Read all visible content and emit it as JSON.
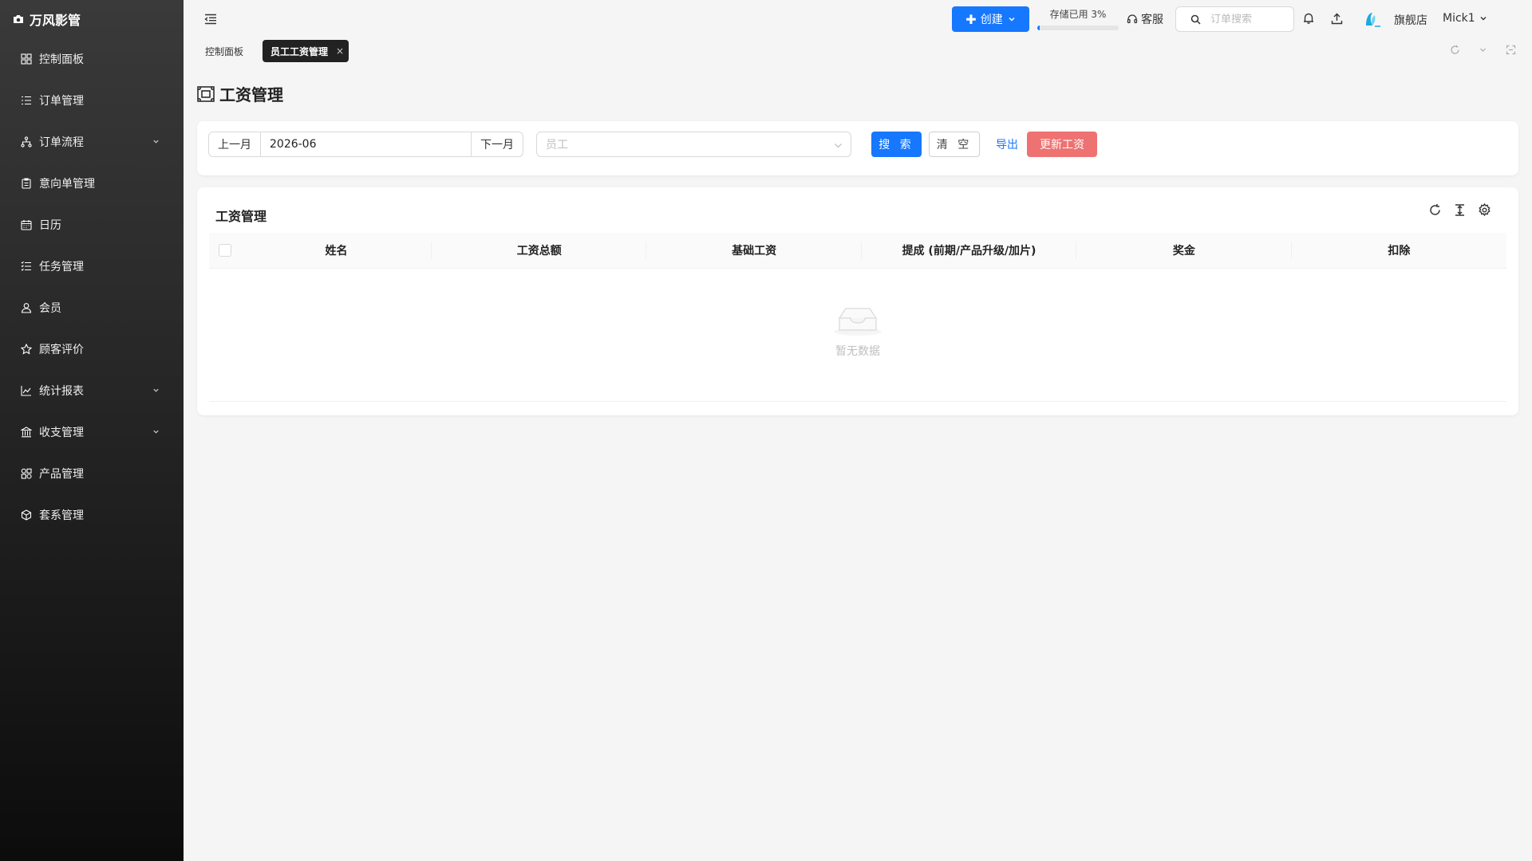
{
  "app": {
    "name": "万风影管"
  },
  "sidebar": {
    "items": [
      {
        "label": "控制面板",
        "icon": "dashboard-icon",
        "expandable": false
      },
      {
        "label": "订单管理",
        "icon": "list-icon",
        "expandable": false
      },
      {
        "label": "订单流程",
        "icon": "flow-icon",
        "expandable": true
      },
      {
        "label": "意向单管理",
        "icon": "clipboard-icon",
        "expandable": false
      },
      {
        "label": "日历",
        "icon": "calendar-icon",
        "expandable": false
      },
      {
        "label": "任务管理",
        "icon": "task-icon",
        "expandable": false
      },
      {
        "label": "会员",
        "icon": "user-icon",
        "expandable": false
      },
      {
        "label": "顾客评价",
        "icon": "star-icon",
        "expandable": false
      },
      {
        "label": "统计报表",
        "icon": "chart-icon",
        "expandable": true
      },
      {
        "label": "收支管理",
        "icon": "bank-icon",
        "expandable": true
      },
      {
        "label": "产品管理",
        "icon": "product-icon",
        "expandable": false
      },
      {
        "label": "套系管理",
        "icon": "package-icon",
        "expandable": false
      }
    ]
  },
  "header": {
    "create_label": "创建",
    "storage_label": "存储已用 3%",
    "storage_fraction": 0.03,
    "service_label": "客服",
    "search_placeholder": "订单搜索",
    "store_label": "旗舰店",
    "user_name": "Mick1"
  },
  "tabs": [
    {
      "label": "控制面板",
      "active": false
    },
    {
      "label": "员工工资管理",
      "active": true,
      "close": "×"
    }
  ],
  "page": {
    "title": "工资管理"
  },
  "filter": {
    "prev_month": "上一月",
    "month_value": "2026-06",
    "next_month": "下一月",
    "employee_placeholder": "员工",
    "search_button": "搜 索",
    "clear_button": "清 空",
    "export_link": "导出",
    "update_button": "更新工资"
  },
  "table": {
    "title": "工资管理",
    "columns": [
      "姓名",
      "工资总额",
      "基础工资",
      "提成 (前期/产品升级/加片)",
      "奖金",
      "扣除"
    ],
    "rows": [],
    "empty_text": "暂无数据"
  },
  "colors": {
    "primary": "#1677ff",
    "danger": "#ef7272",
    "sidebar_top": "#3a3a3a",
    "sidebar_bottom": "#0c0c0c"
  }
}
